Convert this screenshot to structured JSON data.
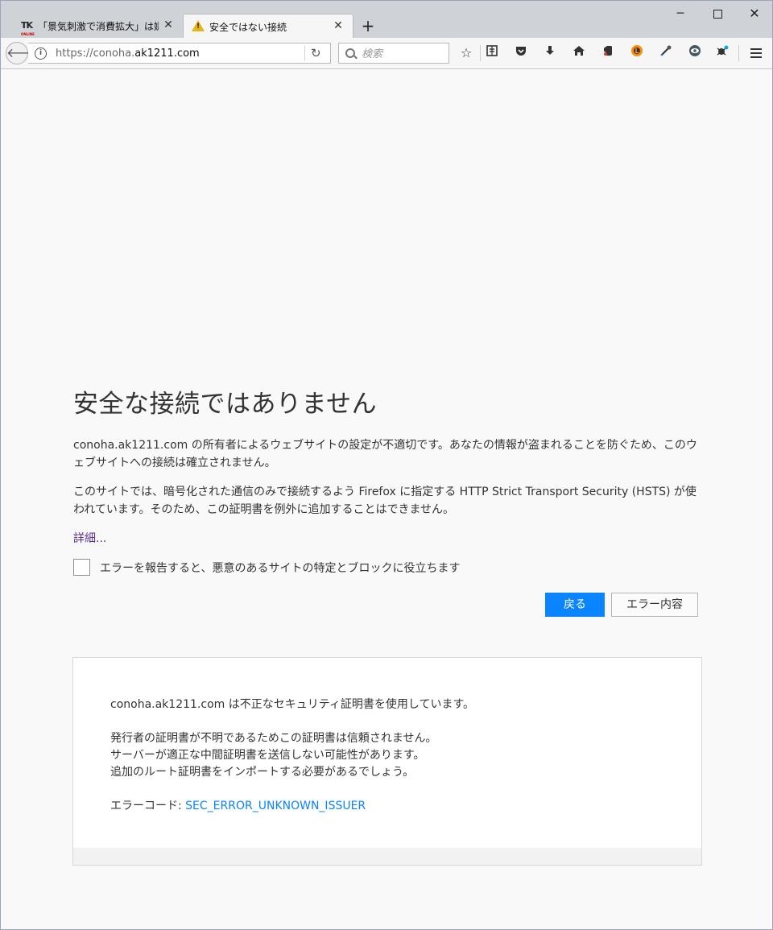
{
  "tabs": [
    {
      "favicon_text": "TK",
      "favicon_sub": "ONLINE",
      "title": "「景気刺激で消費拡大」は嫌言",
      "close": "✕"
    },
    {
      "favicon": "warning-icon",
      "title": "安全ではない接続",
      "close": "✕"
    }
  ],
  "new_tab": "+",
  "window": {
    "minimize": "─",
    "close": "✕"
  },
  "navbar": {
    "url_prefix": "https://conoha.",
    "url_host": "ak1211.com",
    "search_placeholder": "検索"
  },
  "toolbar_icons": [
    "star-icon",
    "reading-list-icon",
    "pocket-icon",
    "download-icon",
    "home-icon",
    "evernote-icon",
    "extension-icon",
    "eyedropper-icon",
    "eye-icon",
    "bug-icon",
    "menu-icon"
  ],
  "error": {
    "title": "安全な接続ではありません",
    "para1": "conoha.ak1211.com の所有者によるウェブサイトの設定が不適切です。あなたの情報が盗まれることを防ぐため、このウェブサイトへの接続は確立されません。",
    "para2": "このサイトでは、暗号化された通信のみで接続するよう Firefox に指定する HTTP Strict Transport Security (HSTS) が使われています。そのため、この証明書を例外に追加することはできません。",
    "details_link": "詳細...",
    "checkbox_label": "エラーを報告すると、悪意のあるサイトの特定とブロックに役立ちます",
    "back_button": "戻る",
    "error_details_button": "エラー内容"
  },
  "details": {
    "line1": "conoha.ak1211.com は不正なセキュリティ証明書を使用しています。",
    "line2": "発行者の証明書が不明であるためこの証明書は信頼されません。",
    "line3": "サーバーが適正な中間証明書を送信しない可能性があります。",
    "line4": "追加のルート証明書をインポートする必要があるでしょう。",
    "code_label": "エラーコード: ",
    "code": "SEC_ERROR_UNKNOWN_ISSUER"
  },
  "colors": {
    "accent": "#0a84ff",
    "link_visited": "#5a2e95",
    "warning": "#e7b416"
  }
}
